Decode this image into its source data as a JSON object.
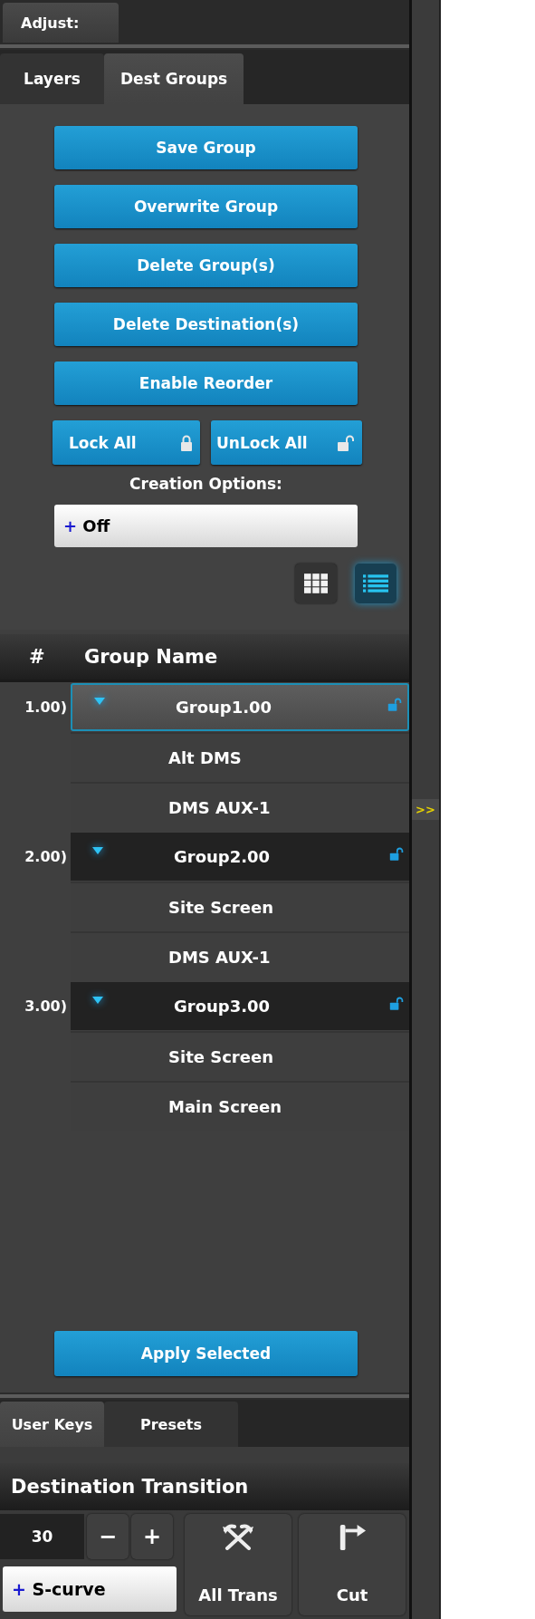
{
  "header_tab": {
    "label": "Adjust:"
  },
  "tabs": [
    {
      "label": "Layers",
      "selected": false
    },
    {
      "label": "Dest Groups",
      "selected": true
    }
  ],
  "buttons": [
    "Save Group",
    "Overwrite Group",
    "Delete Group(s)",
    "Delete Destination(s)",
    "Enable Reorder"
  ],
  "lock_buttons": [
    {
      "label": "Lock All",
      "kind": "lock"
    },
    {
      "label": "UnLock All",
      "kind": "unlock"
    }
  ],
  "creation_options": {
    "label": "Creation Options:",
    "prefix": "+",
    "value": "Off"
  },
  "view_toggle": [
    {
      "kind": "grid",
      "selected": false
    },
    {
      "kind": "list",
      "selected": true
    }
  ],
  "table": {
    "columns": [
      "#",
      "Group Name"
    ],
    "groups": [
      {
        "number": "1.00)",
        "name": "Group1.00",
        "expanded": true,
        "selected": true,
        "locked": false,
        "children": [
          {
            "name": "Alt DMS"
          },
          {
            "name": "DMS AUX-1"
          }
        ]
      },
      {
        "number": "2.00)",
        "name": "Group2.00",
        "expanded": true,
        "selected": false,
        "locked": false,
        "children": [
          {
            "name": "Site Screen"
          },
          {
            "name": "DMS AUX-1"
          }
        ]
      },
      {
        "number": "3.00)",
        "name": "Group3.00",
        "expanded": true,
        "selected": false,
        "locked": false,
        "children": [
          {
            "name": "Site Screen"
          },
          {
            "name": "Main Screen"
          }
        ]
      }
    ]
  },
  "apply_button": "Apply Selected",
  "bottom_tabs": [
    {
      "label": "User Keys",
      "selected": true
    },
    {
      "label": "Presets",
      "selected": false
    }
  ],
  "transition": {
    "title": "Destination Transition",
    "duration": "30",
    "decrement": "−",
    "increment": "+",
    "curve_prefix": "+",
    "curve": "S-curve",
    "actions": [
      {
        "label": "All Trans",
        "kind": "all"
      },
      {
        "label": "Cut",
        "kind": "cut"
      }
    ]
  },
  "side_toggle": ">>"
}
